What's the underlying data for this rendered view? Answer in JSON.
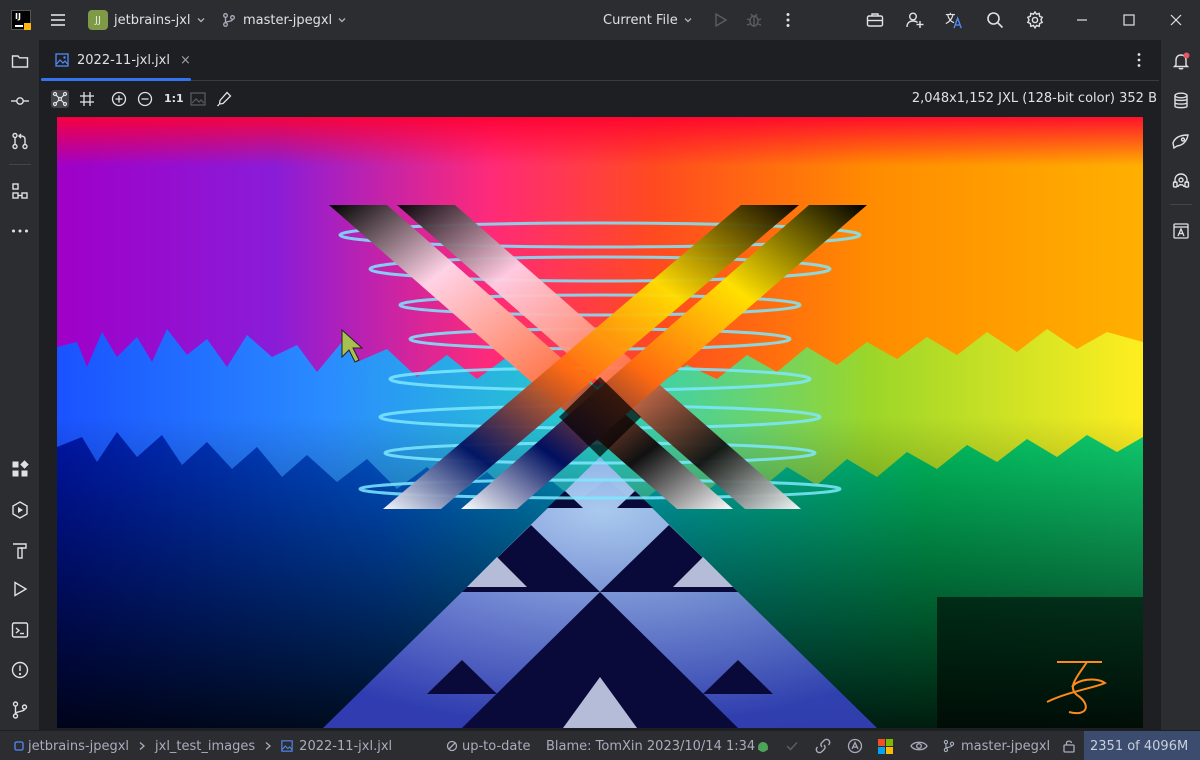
{
  "titlebar": {
    "project_initials": "JJ",
    "project_name": "jetbrains-jxl",
    "branch_name": "master-jpegxl",
    "run_config": "Current File"
  },
  "editor": {
    "tab": {
      "file_name": "2022-11-jxl.jxl",
      "close_glyph": "×"
    },
    "toolbar": {
      "zoom_actual": "1:1",
      "image_info": "2,048x1,152 JXL (128-bit color) 352 B"
    }
  },
  "statusbar": {
    "breadcrumb": [
      "jetbrains-jpegxl",
      "jxl_test_images",
      "2022-11-jxl.jxl"
    ],
    "vcs_status": "up-to-date",
    "blame": "Blame: TomXin 2023/10/14 1:34",
    "branch": "master-jpegxl",
    "memory": "2351 of 4096M"
  },
  "colors": {
    "accent": "#3574f0",
    "panel": "#2b2d30",
    "editor_bg": "#1e1f22",
    "project_badge": "#7e9a47",
    "memory_bg": "#3b4c6e"
  },
  "icons": {
    "left_top": [
      "folder-icon",
      "commit-icon",
      "pull-requests-icon",
      "structure-icon",
      "more-icon"
    ],
    "left_bottom": [
      "plugins-icon",
      "services-icon",
      "build-icon",
      "run-icon",
      "terminal-icon",
      "problems-icon",
      "git-icon"
    ],
    "right": [
      "notifications-icon",
      "database-icon",
      "ai-assistant-icon",
      "code-with-me-icon",
      "translate-panel-icon"
    ]
  }
}
